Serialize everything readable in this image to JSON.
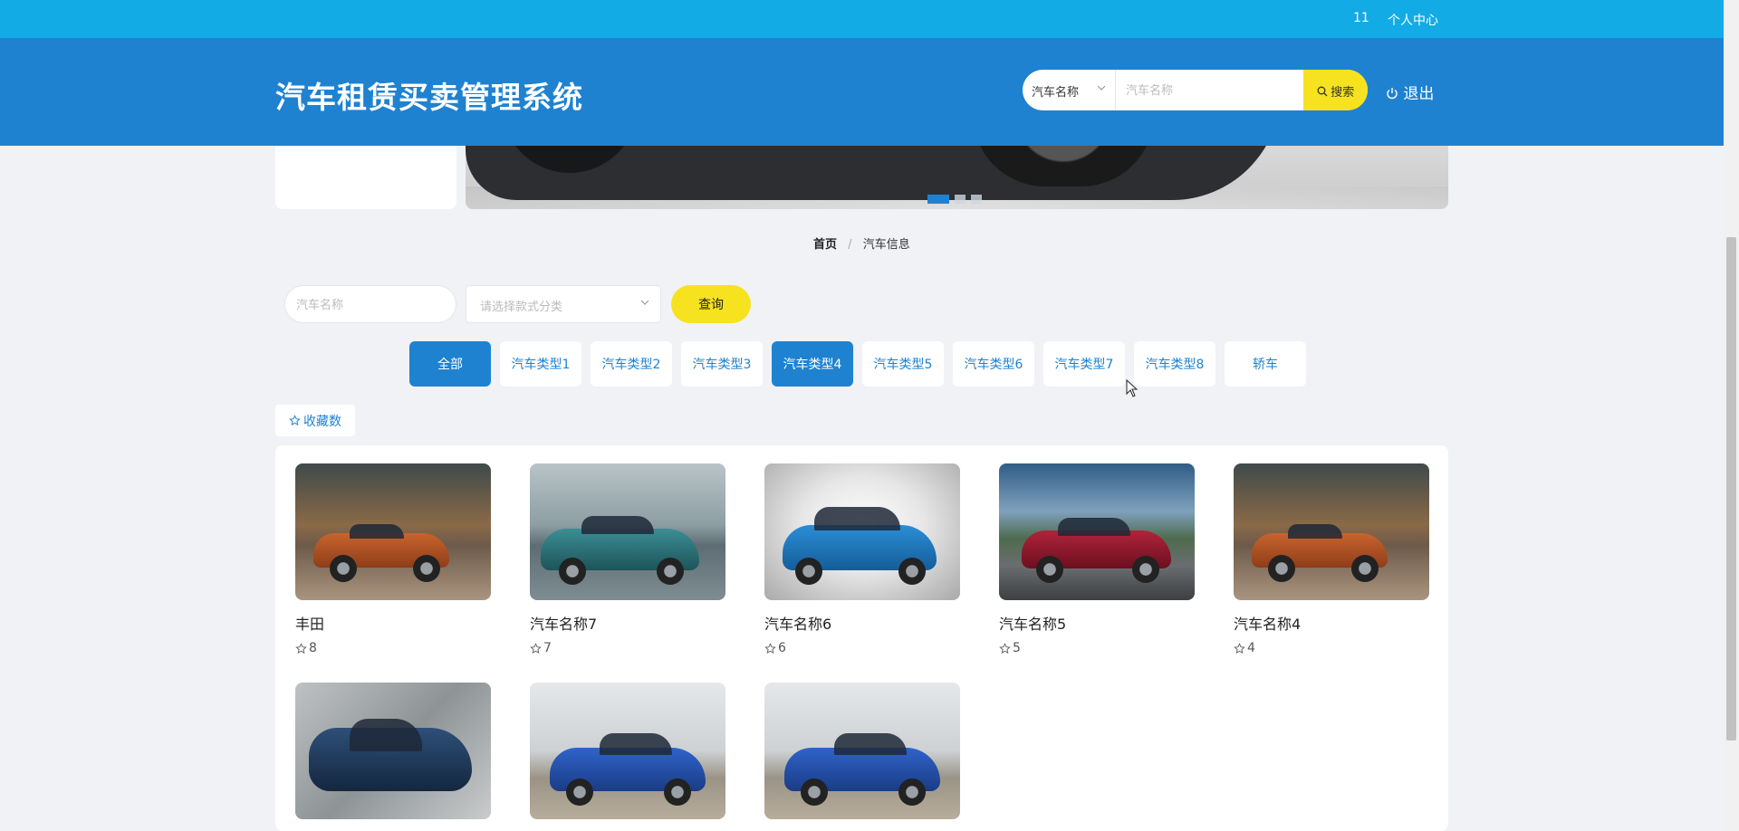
{
  "topbar": {
    "user": "11",
    "personal_center": "个人中心"
  },
  "header": {
    "brand": "汽车租赁买卖管理系统",
    "search": {
      "select_value": "汽车名称",
      "placeholder": "汽车名称",
      "button": "搜索"
    },
    "logout": "退出"
  },
  "carousel": {
    "dots": 3,
    "active_dot": 1
  },
  "breadcrumb": {
    "home": "首页",
    "separator": "/",
    "current": "汽车信息"
  },
  "filter": {
    "name_placeholder": "汽车名称",
    "type_placeholder": "请选择款式分类",
    "query_button": "查询"
  },
  "categories": [
    {
      "label": "全部",
      "active": true
    },
    {
      "label": "汽车类型1",
      "active": false
    },
    {
      "label": "汽车类型2",
      "active": false
    },
    {
      "label": "汽车类型3",
      "active": false
    },
    {
      "label": "汽车类型4",
      "active": true
    },
    {
      "label": "汽车类型5",
      "active": false
    },
    {
      "label": "汽车类型6",
      "active": false
    },
    {
      "label": "汽车类型7",
      "active": false
    },
    {
      "label": "汽车类型8",
      "active": false
    },
    {
      "label": "轿车",
      "active": false
    }
  ],
  "sort": {
    "label": "收藏数"
  },
  "products": [
    {
      "name": "丰田",
      "count": "8"
    },
    {
      "name": "汽车名称7",
      "count": "7"
    },
    {
      "name": "汽车名称6",
      "count": "6"
    },
    {
      "name": "汽车名称5",
      "count": "5"
    },
    {
      "name": "汽车名称4",
      "count": "4"
    },
    {
      "name": "",
      "count": ""
    },
    {
      "name": "",
      "count": ""
    },
    {
      "name": "",
      "count": ""
    }
  ],
  "colors": {
    "primary": "#1f82d0",
    "topbar": "#12abe6",
    "accent": "#f7e21f"
  }
}
